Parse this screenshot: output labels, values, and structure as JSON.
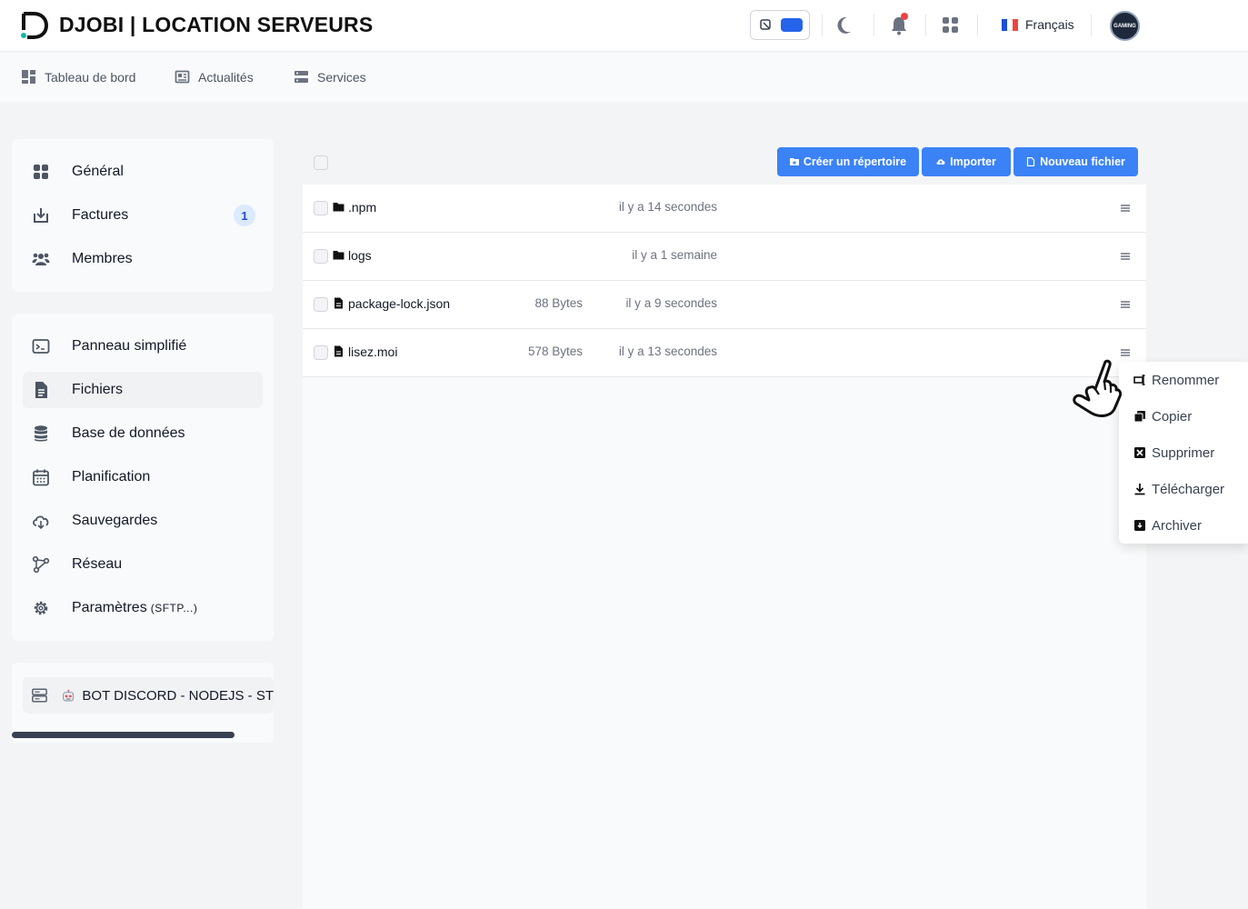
{
  "header": {
    "brand": "DJOBI | LOCATION SERVEURS",
    "language": "Français",
    "avatar_text": "GAMING",
    "icons": [
      "logo-icon",
      "theme-toggle",
      "moon-icon",
      "bell-icon",
      "apps-grid-icon",
      "france-flag-icon"
    ]
  },
  "topnav": {
    "items": [
      {
        "label": "Tableau de bord",
        "icon": "dashboard-icon"
      },
      {
        "label": "Actualités",
        "icon": "newspaper-icon"
      },
      {
        "label": "Services",
        "icon": "server-icon"
      }
    ]
  },
  "sidebar": {
    "account": [
      {
        "label": "Général",
        "icon": "grid-icon"
      },
      {
        "label": "Factures",
        "icon": "invoice-download-icon",
        "badge": "1"
      },
      {
        "label": "Membres",
        "icon": "users-icon"
      }
    ],
    "server": [
      {
        "label": "Panneau simplifié",
        "icon": "terminal-icon"
      },
      {
        "label": "Fichiers",
        "icon": "file-icon",
        "active": true
      },
      {
        "label": "Base de données",
        "icon": "database-icon"
      },
      {
        "label": "Planification",
        "icon": "calendar-icon"
      },
      {
        "label": "Sauvegardes",
        "icon": "cloud-backup-icon"
      },
      {
        "label": "Réseau",
        "icon": "network-icon"
      },
      {
        "label": "Paramètres",
        "suffix": "(SFTP...)",
        "icon": "gear-icon"
      }
    ],
    "server_selector": {
      "label": "BOT DISCORD - NODEJS - ST"
    }
  },
  "toolbar": {
    "create_dir": "Créer un répertoire",
    "import": "Importer",
    "new_file": "Nouveau fichier"
  },
  "files": [
    {
      "name": ".npm",
      "type": "folder",
      "size": "",
      "modified": "il y a 14 secondes"
    },
    {
      "name": "logs",
      "type": "folder",
      "size": "",
      "modified": "il y a 1 semaine"
    },
    {
      "name": "package-lock.json",
      "type": "file",
      "size": "88 Bytes",
      "modified": "il y a 9 secondes"
    },
    {
      "name": "lisez.moi",
      "type": "file",
      "size": "578 Bytes",
      "modified": "il y a 13 secondes"
    }
  ],
  "context_menu": {
    "items": [
      {
        "label": "Renommer",
        "icon": "rename-icon"
      },
      {
        "label": "Copier",
        "icon": "copy-icon"
      },
      {
        "label": "Supprimer",
        "icon": "delete-icon"
      },
      {
        "label": "Télécharger",
        "icon": "download-icon"
      },
      {
        "label": "Archiver",
        "icon": "archive-icon"
      }
    ]
  },
  "colors": {
    "primary": "#3b82f6",
    "toggle_accent": "#2563eb",
    "badge_bg": "#dbeafe",
    "notification_dot": "#ef4444"
  }
}
